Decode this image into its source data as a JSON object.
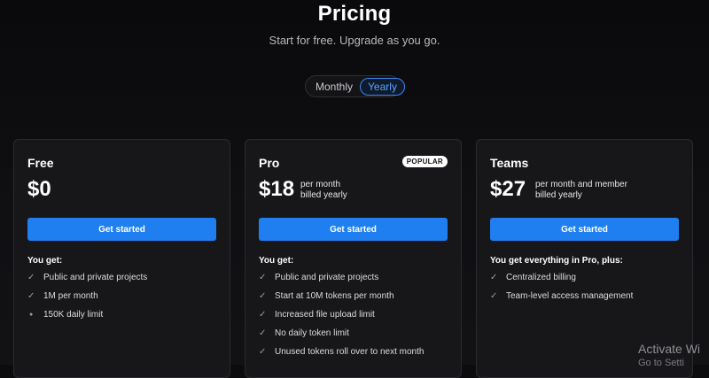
{
  "header": {
    "title": "Pricing",
    "subtitle": "Start for free. Upgrade as you go."
  },
  "billing_toggle": {
    "options": [
      "Monthly",
      "Yearly"
    ],
    "selected": "Yearly"
  },
  "plans": [
    {
      "name": "Free",
      "price": "$0",
      "price_note": [],
      "cta": "Get started",
      "features_heading": "You get:",
      "features": [
        {
          "text": "Public and private projects",
          "mark": "check"
        },
        {
          "text": "1M per month",
          "mark": "check"
        },
        {
          "text": "150K daily limit",
          "mark": "dot"
        }
      ]
    },
    {
      "name": "Pro",
      "badge": "POPULAR",
      "price": "$18",
      "price_note": [
        "per month",
        "billed yearly"
      ],
      "cta": "Get started",
      "features_heading": "You get:",
      "features": [
        {
          "text": "Public and private projects",
          "mark": "check"
        },
        {
          "text": "Start at 10M tokens per month",
          "mark": "check"
        },
        {
          "text": "Increased file upload limit",
          "mark": "check"
        },
        {
          "text": "No daily token limit",
          "mark": "check"
        },
        {
          "text": "Unused tokens roll over to next month",
          "mark": "check"
        }
      ]
    },
    {
      "name": "Teams",
      "price": "$27",
      "price_note": [
        "per month and member",
        "billed yearly"
      ],
      "cta": "Get started",
      "features_heading": "You get everything in Pro, plus:",
      "features": [
        {
          "text": "Centralized billing",
          "mark": "check"
        },
        {
          "text": "Team-level access management",
          "mark": "check"
        }
      ]
    }
  ],
  "icons": {
    "check": "check-icon",
    "dot": "bullet-icon"
  },
  "colors": {
    "accent": "#1f7ff0",
    "background": "#0c0c0e",
    "card": "#17171a"
  },
  "watermark": {
    "line1": "Activate Wi",
    "line2": "Go to Setti"
  }
}
